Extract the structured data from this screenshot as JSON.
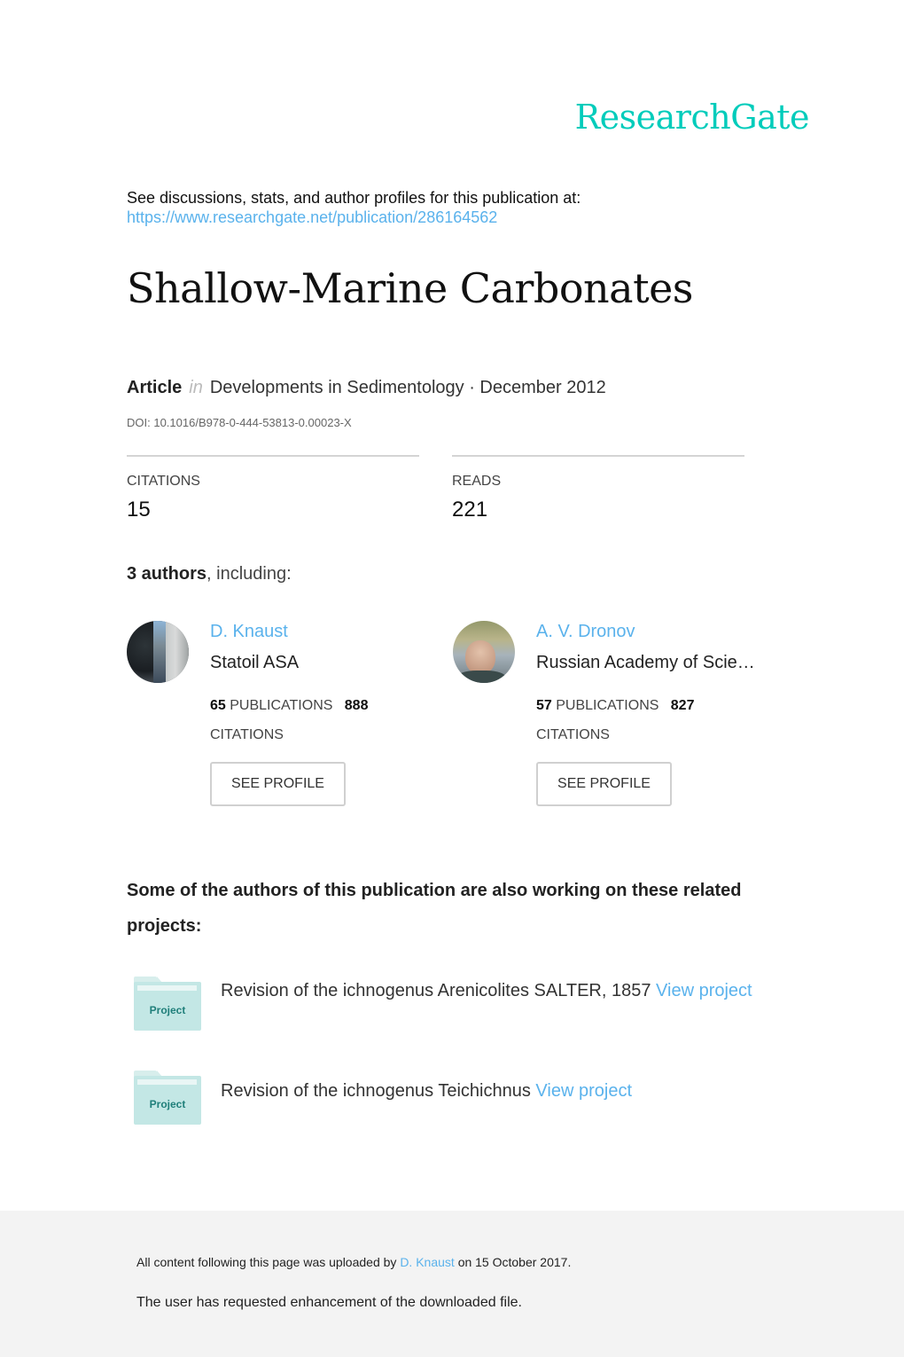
{
  "brand": {
    "logo_text": "ResearchGate",
    "accent_color": "#00ccbb",
    "link_color": "#5ab2ec"
  },
  "intro": {
    "text": "See discussions, stats, and author profiles for this publication at:",
    "url": "https://www.researchgate.net/publication/286164562"
  },
  "publication": {
    "title": "Shallow-Marine Carbonates",
    "type": "Article",
    "in_word": "in",
    "venue_date": "Developments in Sedimentology · December 2012",
    "doi": "DOI: 10.1016/B978-0-444-53813-0.00023-X"
  },
  "stats": {
    "citations_label": "CITATIONS",
    "citations_value": "15",
    "reads_label": "READS",
    "reads_value": "221"
  },
  "authors_heading": {
    "count": "3 authors",
    "suffix": ", including:"
  },
  "authors": [
    {
      "name": "D. Knaust",
      "institution": "Statoil ASA",
      "publications": "65",
      "publications_label": "PUBLICATIONS",
      "citations": "888",
      "citations_label": "CITATIONS",
      "button_label": "SEE PROFILE"
    },
    {
      "name": "A. V. Dronov",
      "institution": "Russian Academy of Scie…",
      "publications": "57",
      "publications_label": "PUBLICATIONS",
      "citations": "827",
      "citations_label": "CITATIONS",
      "button_label": "SEE PROFILE"
    }
  ],
  "projects_heading": "Some of the authors of this publication are also working on these related projects:",
  "projects": [
    {
      "icon_label": "Project",
      "title": "Revision of the ichnogenus Arenicolites SALTER, 1857",
      "link": "View project"
    },
    {
      "icon_label": "Project",
      "title": "Revision of the ichnogenus Teichichnus",
      "link": "View project"
    }
  ],
  "footer": {
    "upload_prefix": "All content following this page was uploaded by",
    "uploader": "D. Knaust",
    "upload_suffix": "on 15 October 2017.",
    "request_text": "The user has requested enhancement of the downloaded file."
  }
}
